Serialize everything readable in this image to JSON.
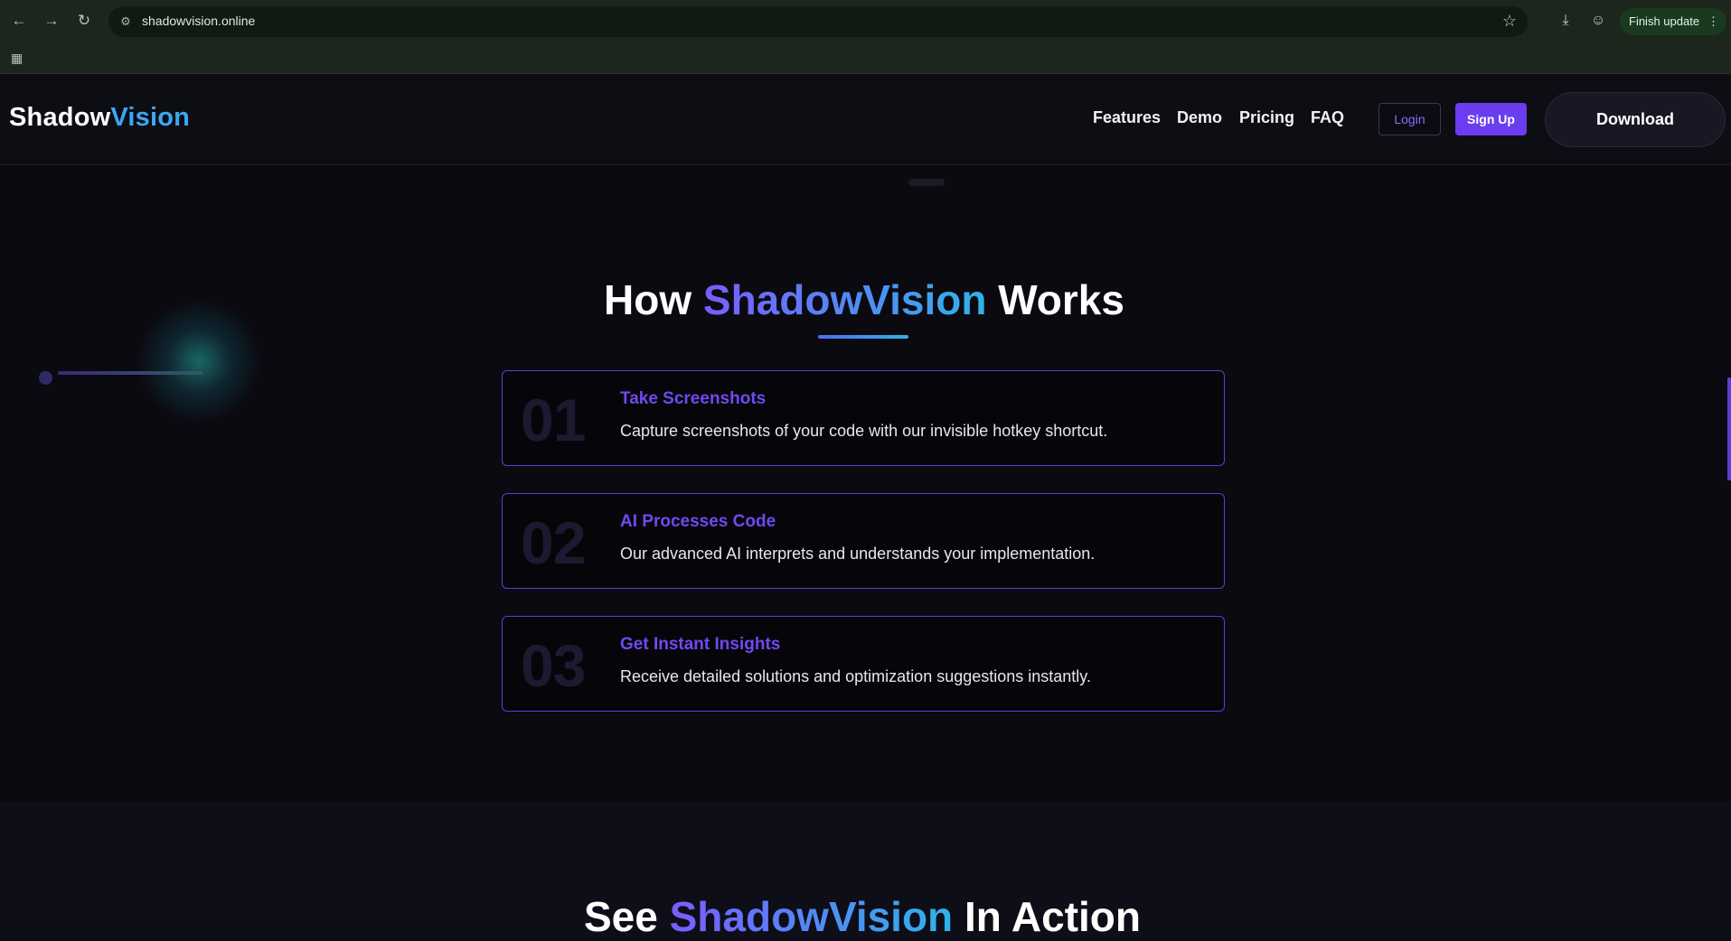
{
  "browser": {
    "url": "shadowvision.online",
    "update_label": "Finish update",
    "icons": {
      "back": "arrow-left-icon",
      "forward": "arrow-right-icon",
      "reload": "reload-icon",
      "site_info": "site-info-icon",
      "bookmark": "star-icon",
      "downloads": "download-icon",
      "profile": "profile-icon",
      "apps": "apps-grid-icon"
    }
  },
  "header": {
    "logo_part1": "Shadow",
    "logo_part2": "Vision",
    "nav": [
      "Features",
      "Demo",
      "Pricing",
      "FAQ"
    ],
    "login_label": "Login",
    "signup_label": "Sign Up",
    "download_label": "Download"
  },
  "how_section": {
    "title_prefix": "How",
    "title_brand": "ShadowVision",
    "title_suffix": "Works",
    "steps": [
      {
        "num": "01",
        "title": "Take Screenshots",
        "desc": "Capture screenshots of your code with our invisible hotkey shortcut."
      },
      {
        "num": "02",
        "title": "AI Processes Code",
        "desc": "Our advanced AI interprets and understands your implementation."
      },
      {
        "num": "03",
        "title": "Get Instant Insights",
        "desc": "Receive detailed solutions and optimization suggestions instantly."
      }
    ]
  },
  "demo_section": {
    "title_prefix": "See",
    "title_brand": "ShadowVision",
    "title_suffix": "In Action"
  },
  "colors": {
    "accent_purple": "#6b3df0",
    "brand_blue": "#3ba8f0",
    "card_border": "#5a3fd6"
  }
}
